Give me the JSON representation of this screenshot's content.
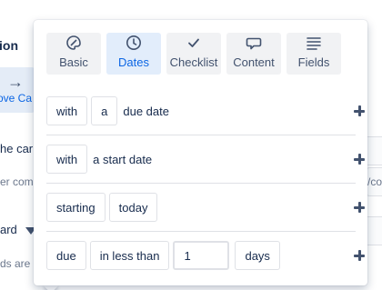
{
  "background": {
    "title_fragment": "ion",
    "tile_label_fragment": "ove Ca",
    "row1_fragment": "he car",
    "row2_fragment": "er com",
    "row2_right_fragment": "/co",
    "row3_fragment": "ard",
    "row4_fragment": "ds are"
  },
  "popover": {
    "tabs": [
      {
        "label": "Basic",
        "icon": "palette-icon",
        "active": false
      },
      {
        "label": "Dates",
        "icon": "clock-icon",
        "active": true
      },
      {
        "label": "Checklist",
        "icon": "check-icon",
        "active": false
      },
      {
        "label": "Content",
        "icon": "speech-bubble-icon",
        "active": false
      },
      {
        "label": "Fields",
        "icon": "lines-icon",
        "active": false
      }
    ],
    "rules": {
      "due_date": {
        "chip1": "with",
        "chip2": "a",
        "text": "due date"
      },
      "start_date": {
        "chip1": "with",
        "text": "a start date"
      },
      "starting": {
        "chip1": "starting",
        "chip2": "today"
      },
      "due_in": {
        "chip1": "due",
        "chip2": "in less than",
        "value": "1",
        "chip3": "days"
      }
    }
  },
  "colors": {
    "accent": "#0c66e4",
    "tab_active_bg": "#e2edfb",
    "tab_bg": "#f1f2f4"
  }
}
